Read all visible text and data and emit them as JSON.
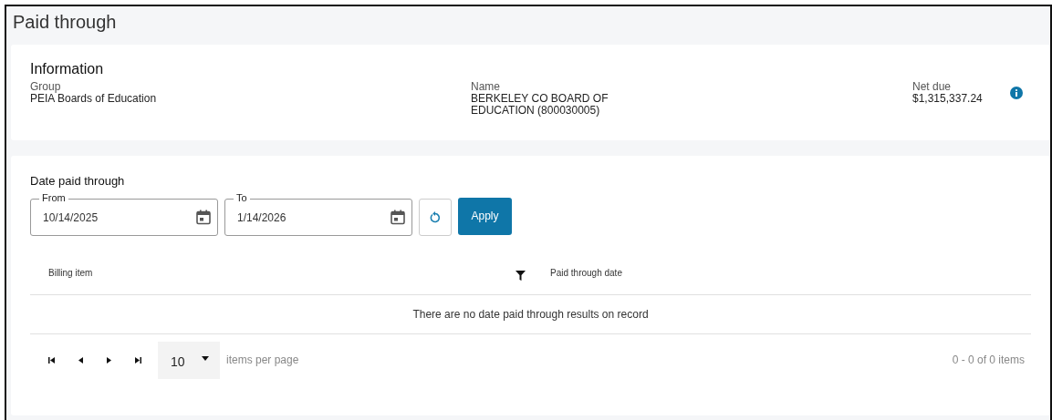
{
  "page": {
    "title": "Paid through"
  },
  "information": {
    "title": "Information",
    "fields": [
      {
        "label": "Group",
        "value": "PEIA Boards of Education"
      },
      {
        "label": "Name",
        "value": "BERKELEY CO BOARD OF EDUCATION (800030005)"
      },
      {
        "label": "Net due",
        "value": "$1,315,337.24"
      }
    ]
  },
  "filter": {
    "title": "Date paid through",
    "from": {
      "label": "From",
      "value": "10/14/2025"
    },
    "to": {
      "label": "To",
      "value": "1/14/2026"
    },
    "apply": "Apply"
  },
  "table": {
    "columns": [
      "Billing item",
      "Paid through date"
    ],
    "empty_message": "There are no date paid through results on record"
  },
  "pager": {
    "page_size": "10",
    "page_size_label": "items per page",
    "summary": "0 - 0 of 0 items"
  }
}
